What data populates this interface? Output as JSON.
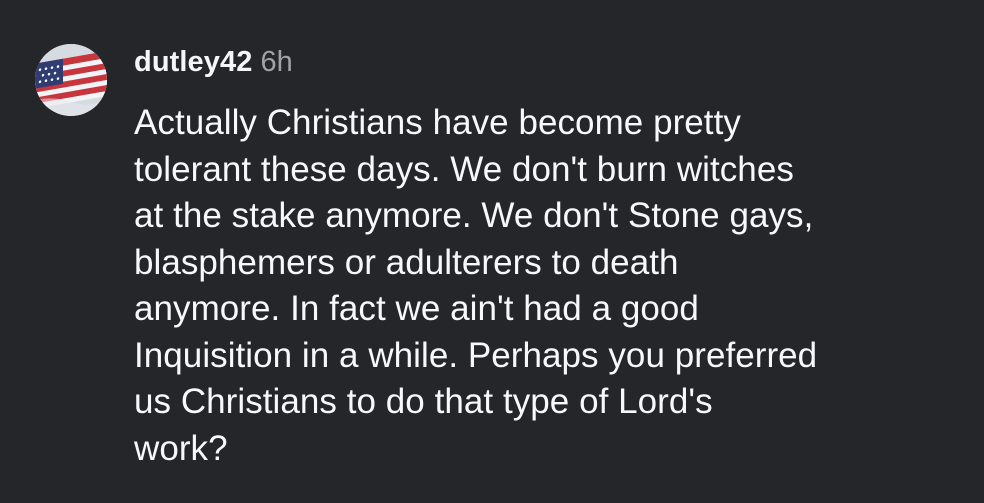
{
  "comment": {
    "username": "dutley42",
    "timestamp": "6h",
    "avatar_icon": "american-flag-icon",
    "body_lines": [
      "Actually Christians have become pretty",
      "tolerant these days. We don't burn witches",
      "at the stake anymore. We don't Stone gays,",
      "blasphemers or adulterers to death",
      "anymore. In fact we ain't had a good",
      "Inquisition in a while. Perhaps you preferred",
      "us Christians to do that type of Lord's",
      "work?"
    ]
  },
  "colors": {
    "background": "#242629",
    "text": "#f7f8f9",
    "timestamp": "#9ea3aa",
    "flag_red": "#c7363c",
    "flag_blue": "#2f3d73"
  }
}
